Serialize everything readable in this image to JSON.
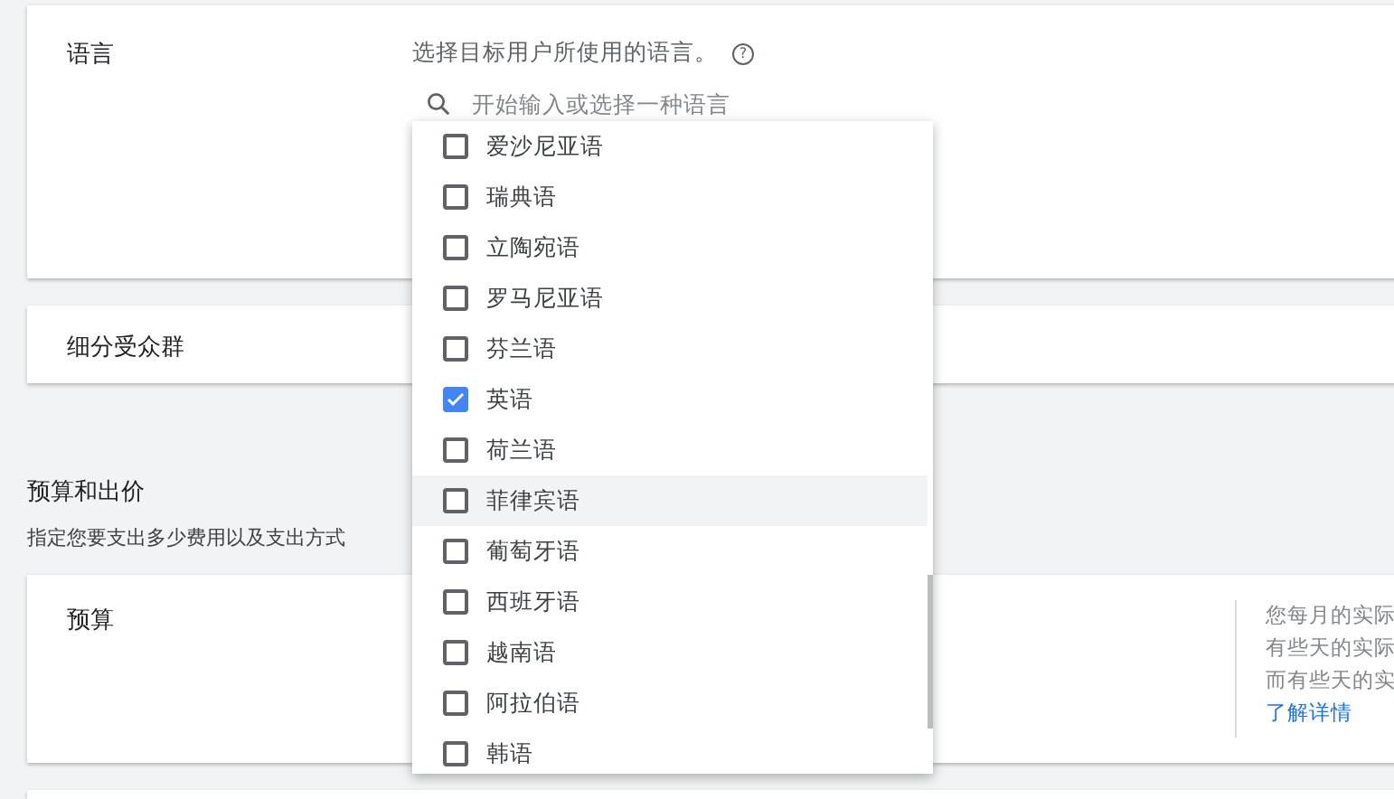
{
  "language_card": {
    "label": "语言",
    "help_text": "选择目标用户所使用的语言。",
    "help_icon": "?",
    "search": {
      "placeholder": "开始输入或选择一种语言"
    },
    "options": [
      {
        "label": "爱沙尼亚语",
        "checked": false,
        "hovered": false
      },
      {
        "label": "瑞典语",
        "checked": false,
        "hovered": false
      },
      {
        "label": "立陶宛语",
        "checked": false,
        "hovered": false
      },
      {
        "label": "罗马尼亚语",
        "checked": false,
        "hovered": false
      },
      {
        "label": "芬兰语",
        "checked": false,
        "hovered": false
      },
      {
        "label": "英语",
        "checked": true,
        "hovered": false
      },
      {
        "label": "荷兰语",
        "checked": false,
        "hovered": false
      },
      {
        "label": "菲律宾语",
        "checked": false,
        "hovered": true
      },
      {
        "label": "葡萄牙语",
        "checked": false,
        "hovered": false
      },
      {
        "label": "西班牙语",
        "checked": false,
        "hovered": false
      },
      {
        "label": "越南语",
        "checked": false,
        "hovered": false
      },
      {
        "label": "阿拉伯语",
        "checked": false,
        "hovered": false
      },
      {
        "label": "韩语",
        "checked": false,
        "hovered": false
      }
    ]
  },
  "audience_card": {
    "label": "细分受众群"
  },
  "budget_section": {
    "title": "预算和出价",
    "subtitle": "指定您要支出多少费用以及支出方式"
  },
  "budget_card": {
    "label": "预算",
    "info_lines": [
      "您每月的实际",
      "有些天的实际",
      "而有些天的实"
    ],
    "learn_more": "了解详情"
  }
}
